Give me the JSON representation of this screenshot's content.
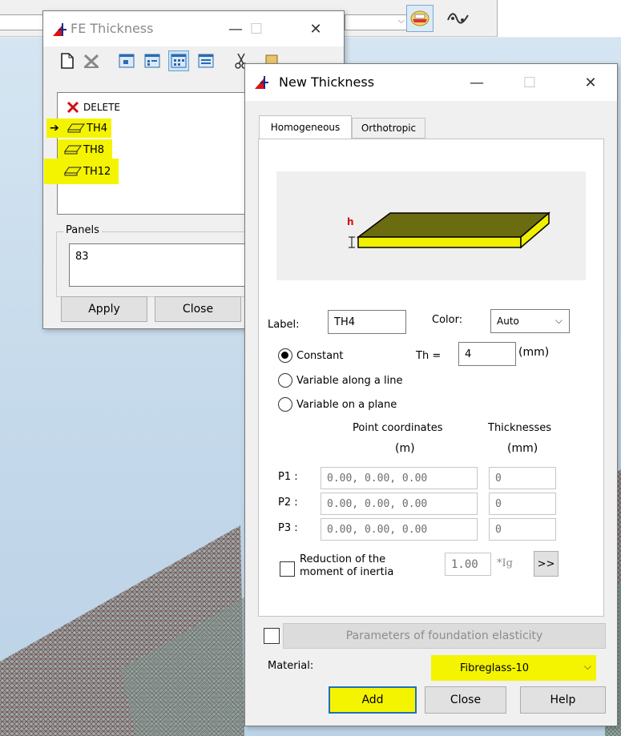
{
  "host": {
    "toolbar_icons": [
      "dropdown-arrow-icon",
      "cross-section-icon",
      "wave-signal-icon"
    ]
  },
  "fe_window": {
    "title": "FE Thickness",
    "toolbar_icons": [
      "new-document-icon",
      "delete-icon",
      "view-small-icon",
      "view-medium-icon",
      "view-grid-icon",
      "view-list-icon",
      "cut-icon",
      "paste-icon"
    ],
    "list": [
      {
        "label": "DELETE",
        "icon": "red-x-icon",
        "highlighted": false,
        "current": false
      },
      {
        "label": "TH4",
        "icon": "plate-icon",
        "highlighted": true,
        "current": true
      },
      {
        "label": "TH8",
        "icon": "plate-icon",
        "highlighted": true,
        "current": false
      },
      {
        "label": "TH12",
        "icon": "plate-icon",
        "highlighted": true,
        "current": false
      }
    ],
    "panels_label": "Panels",
    "panels_value": "83",
    "apply_label": "Apply",
    "close_label": "Close"
  },
  "new_window": {
    "title": "New Thickness",
    "tabs": [
      "Homogeneous",
      "Orthotropic"
    ],
    "active_tab": "Homogeneous",
    "illustration_label": "h",
    "label_caption": "Label:",
    "label_value": "TH4",
    "color_caption": "Color:",
    "color_value": "Auto",
    "radio_constant": "Constant",
    "th_caption": "Th =",
    "th_value": "4",
    "th_unit": "(mm)",
    "radio_line": "Variable along a line",
    "radio_plane": "Variable on a plane",
    "coords_header_1": "Point coordinates",
    "coords_header_2": "(m)",
    "thick_header_1": "Thicknesses",
    "thick_header_2": "(mm)",
    "points": [
      {
        "label": "P1 :",
        "coords": "0.00, 0.00, 0.00",
        "thickness": "0"
      },
      {
        "label": "P2 :",
        "coords": "0.00, 0.00, 0.00",
        "thickness": "0"
      },
      {
        "label": "P3 :",
        "coords": "0.00, 0.00, 0.00",
        "thickness": "0"
      }
    ],
    "reduction_line1": "Reduction of the",
    "reduction_line2": "moment of inertia",
    "reduction_value": "1.00",
    "reduction_unit": "*Ig",
    "more_label": ">>",
    "foundation_label": "Parameters of foundation elasticity",
    "material_caption": "Material:",
    "material_value": "Fibreglass-10",
    "add_label": "Add",
    "close_label": "Close",
    "help_label": "Help"
  },
  "colors": {
    "highlight": "#f4f400",
    "delete_red": "#d01010",
    "plate_yellow": "#f0f000",
    "plate_top": "#6b6b10"
  }
}
